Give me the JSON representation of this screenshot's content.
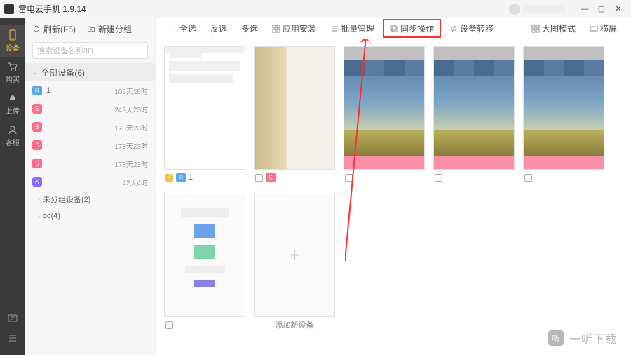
{
  "titlebar": {
    "title": "雷电云手机 1.9.14"
  },
  "rail": {
    "items": [
      {
        "label": "设备",
        "icon": "device"
      },
      {
        "label": "购买",
        "icon": "cart"
      },
      {
        "label": "上传",
        "icon": "upload"
      },
      {
        "label": "客服",
        "icon": "support"
      }
    ]
  },
  "sidebar": {
    "refresh_label": "刷新(F5)",
    "newgroup_label": "新建分组",
    "search_placeholder": "搜索设备名称/ID",
    "group_all_label": "全部设备(6)",
    "devices": [
      {
        "badge": "R",
        "badge_color": "#5aa7f0",
        "name": "1",
        "time": "105天16时"
      },
      {
        "badge": "S",
        "badge_color": "#ff6b8a",
        "name": "",
        "time": "249天23时"
      },
      {
        "badge": "S",
        "badge_color": "#ff6b8a",
        "name": "",
        "time": "178天23时"
      },
      {
        "badge": "S",
        "badge_color": "#ff6b8a",
        "name": "",
        "time": "178天23时"
      },
      {
        "badge": "S",
        "badge_color": "#ff6b8a",
        "name": "",
        "time": "178天23时"
      },
      {
        "badge": "K",
        "badge_color": "#8a6bff",
        "name": "",
        "time": "42天4时"
      }
    ],
    "sub_groups": [
      {
        "label": "未分组设备(2)"
      },
      {
        "label": "oc(4)"
      }
    ]
  },
  "toolbar": {
    "select_all": "全选",
    "invert": "反选",
    "multi": "多选",
    "app_install": "应用安装",
    "batch_manage": "批量管理",
    "sync_op": "同步操作",
    "dev_transfer": "设备转移",
    "large_mode": "大图模式",
    "landscape": "横屏"
  },
  "grid": {
    "cards": [
      {
        "checked": true,
        "badge": "R",
        "badge_color": "#5aa7f0",
        "name": "1",
        "screen": "doc"
      },
      {
        "checked": false,
        "badge": "S",
        "badge_color": "#ff6b8a",
        "name": "",
        "screen": "room"
      },
      {
        "checked": false,
        "badge": "",
        "badge_color": "",
        "name": "",
        "screen": "home"
      },
      {
        "checked": false,
        "badge": "",
        "badge_color": "",
        "name": "",
        "screen": "home"
      },
      {
        "checked": false,
        "badge": "",
        "badge_color": "",
        "name": "",
        "screen": "home"
      },
      {
        "checked": false,
        "badge": "",
        "badge_color": "",
        "name": "",
        "screen": "light"
      }
    ],
    "add_label": "添加新设备"
  },
  "watermark": {
    "icon_text": "听",
    "text": "一听下载"
  }
}
